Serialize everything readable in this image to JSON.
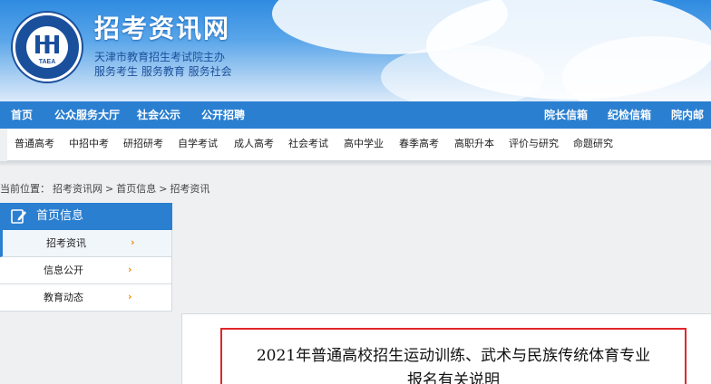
{
  "header": {
    "site_title": "招考资讯网",
    "subtitle_line1": "天津市教育招生考试院主办",
    "subtitle_line2": "服务考生 服务教育 服务社会",
    "logo_text": "TAEA"
  },
  "top_nav": {
    "items": [
      "首页",
      "公众服务大厅",
      "社会公示",
      "公开招聘",
      "院长信箱",
      "纪检信箱",
      "院内邮箱"
    ]
  },
  "sub_nav": {
    "items": [
      "普通高考",
      "中招中考",
      "研招研考",
      "自学考试",
      "成人高考",
      "社会考试",
      "高中学业",
      "春季高考",
      "高职升本",
      "评价与研究",
      "命题研究"
    ]
  },
  "breadcrumb": {
    "prefix": "当前位置：",
    "items": [
      "招考资讯网",
      "首页信息",
      "招考资讯"
    ],
    "separator": ">"
  },
  "left_menu": {
    "title": "首页信息",
    "items": [
      {
        "label": "招考资讯",
        "arrow": "›"
      },
      {
        "label": "信息公开",
        "arrow": "›"
      },
      {
        "label": "教育动态",
        "arrow": "›"
      }
    ],
    "active_index": 0
  },
  "article": {
    "title_line1": "2021年普通高校招生运动训练、武术与民族传统体育专业",
    "title_line2": "报名有关说明"
  },
  "colors": {
    "nav_blue": "#2a7fd0",
    "title_border_red": "#e0272a",
    "arrow_orange": "#f08a00"
  }
}
